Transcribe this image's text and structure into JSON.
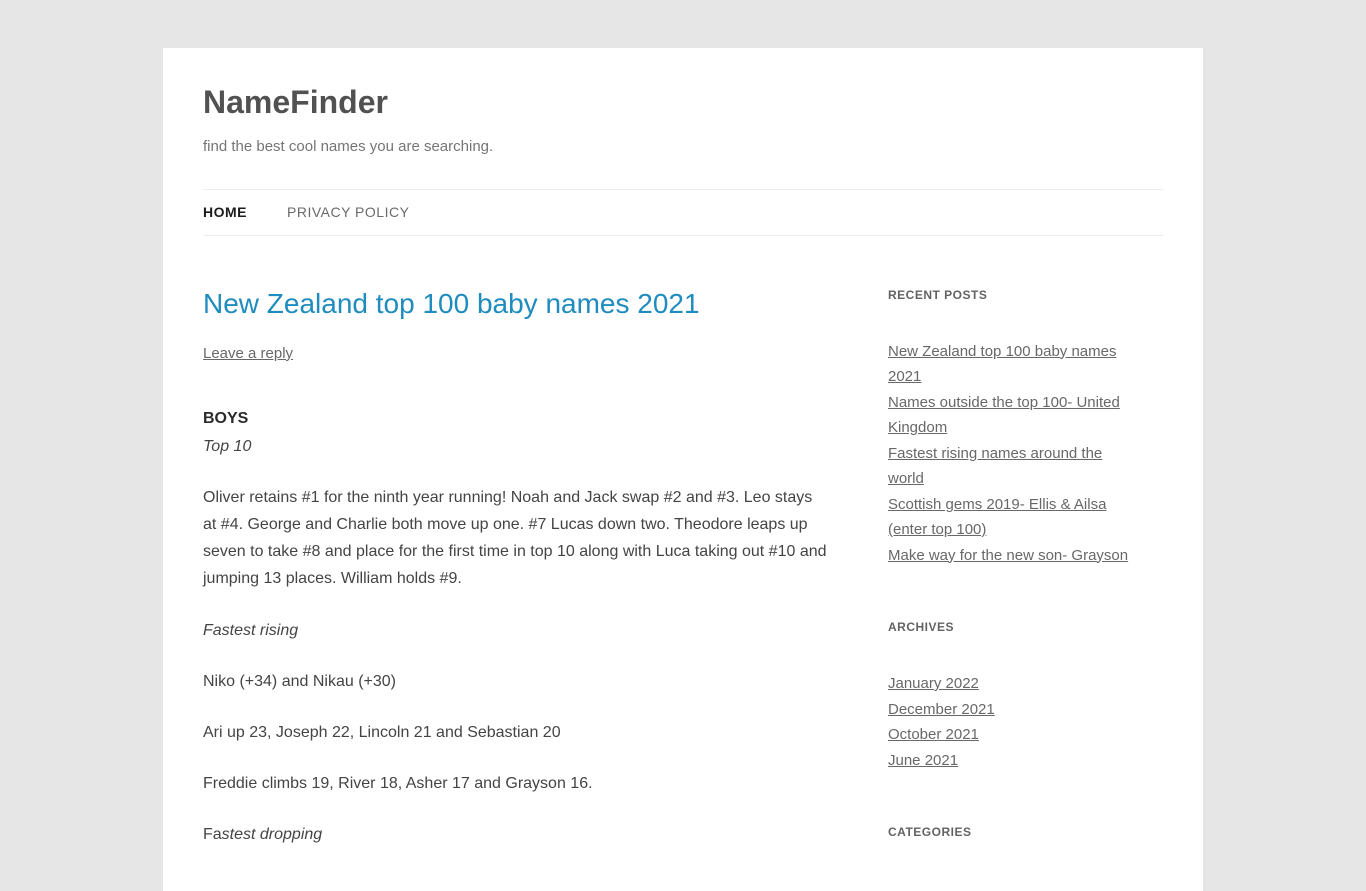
{
  "header": {
    "site_title": "NameFinder",
    "tagline": "find the best cool names you are searching."
  },
  "nav": {
    "items": [
      {
        "label": "HOME",
        "active": true
      },
      {
        "label": "PRIVACY POLICY",
        "active": false
      }
    ]
  },
  "post": {
    "title": "New Zealand top 100 baby names 2021",
    "reply_link": "Leave a reply",
    "body": {
      "boys_heading": "BOYS",
      "top10_label": "Top 10",
      "top10_text": "Oliver retains #1 for the ninth year running! Noah and Jack swap #2 and #3. Leo stays at #4. George and Charlie both move up one. #7 Lucas down two. Theodore leaps up seven to take #8 and place for the first time in top 10 along with Luca taking out #10 and jumping 13 places. William holds #9.",
      "fastest_rising_label": "Fastest rising",
      "p1": "Niko (+34) and Nikau (+30)",
      "p2": "Ari up 23, Joseph 22, Lincoln 21 and Sebastian 20",
      "p3": "Freddie climbs 19, River 18, Asher 17 and Grayson 16.",
      "fastest_dropping_prefix": "Fa",
      "fastest_dropping_suffix": "stest dropping"
    }
  },
  "sidebar": {
    "recent_posts": {
      "title": "RECENT POSTS",
      "items": [
        "New Zealand top 100 baby names 2021",
        "Names outside the top 100- United Kingdom",
        "Fastest rising names around the world",
        "Scottish gems 2019- Ellis & Ailsa (enter top 100)",
        "Make way for the new son- Grayson"
      ]
    },
    "archives": {
      "title": "ARCHIVES",
      "items": [
        "January 2022",
        "December 2021",
        "October 2021",
        "June 2021"
      ]
    },
    "categories": {
      "title": "CATEGORIES"
    }
  }
}
